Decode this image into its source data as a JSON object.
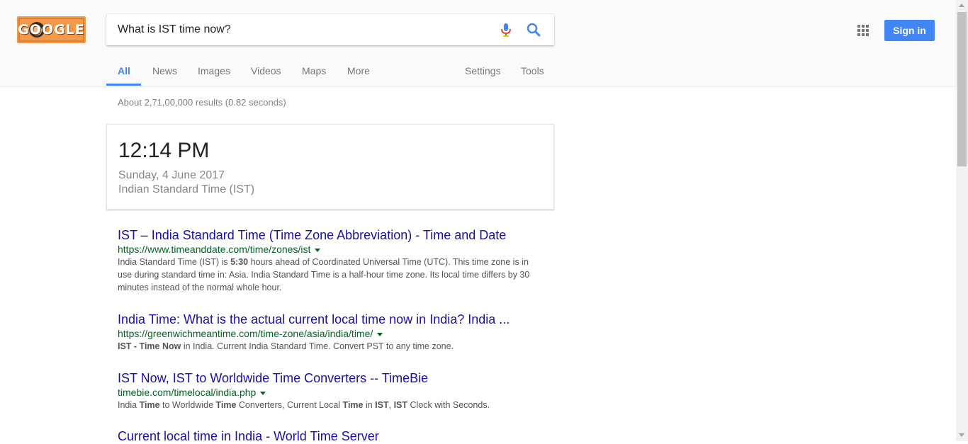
{
  "logo": {
    "text": "GOOGLE"
  },
  "search": {
    "value": "What is IST time now?"
  },
  "header": {
    "signin_label": "Sign in"
  },
  "tabs": [
    {
      "label": "All"
    },
    {
      "label": "News"
    },
    {
      "label": "Images"
    },
    {
      "label": "Videos"
    },
    {
      "label": "Maps"
    },
    {
      "label": "More"
    },
    {
      "label": "Settings"
    },
    {
      "label": "Tools"
    }
  ],
  "stats": "About 2,71,00,000 results (0.82 seconds)",
  "card": {
    "time": "12:14 PM",
    "date": "Sunday, 4 June 2017",
    "zone": "Indian Standard Time (IST)"
  },
  "results": [
    {
      "title": "IST – India Standard Time (Time Zone Abbreviation) - Time and Date",
      "url": "https://www.timeanddate.com/time/zones/ist",
      "snippet_parts": [
        "India Standard Time (IST) is ",
        "5:30",
        " hours ahead of Coordinated Universal Time (UTC). This time zone is in use during standard time in: Asia. India Standard Time is a half-hour time zone. Its local time differs by 30 minutes instead of the normal whole hour."
      ]
    },
    {
      "title": "India Time: What is the actual current local time now in India? India ...",
      "url": "https://greenwichmeantime.com/time-zone/asia/india/time/",
      "snippet_parts": [
        "IST - Time Now",
        " in India. Current India Standard Time. Convert PST to any time zone."
      ]
    },
    {
      "title": "IST Now, IST to Worldwide Time Converters -- TimeBie",
      "url": "timebie.com/timelocal/india.php",
      "snippet_parts": [
        "India ",
        "Time",
        " to Worldwide ",
        "Time",
        " Converters, Current Local ",
        "Time",
        " in ",
        "IST",
        ", ",
        "IST",
        " Clock with Seconds."
      ]
    },
    {
      "title": "Current local time in India - World Time Server"
    }
  ],
  "colors": {
    "accent": "#4285f4",
    "link": "#1a0dab",
    "url": "#006621"
  }
}
